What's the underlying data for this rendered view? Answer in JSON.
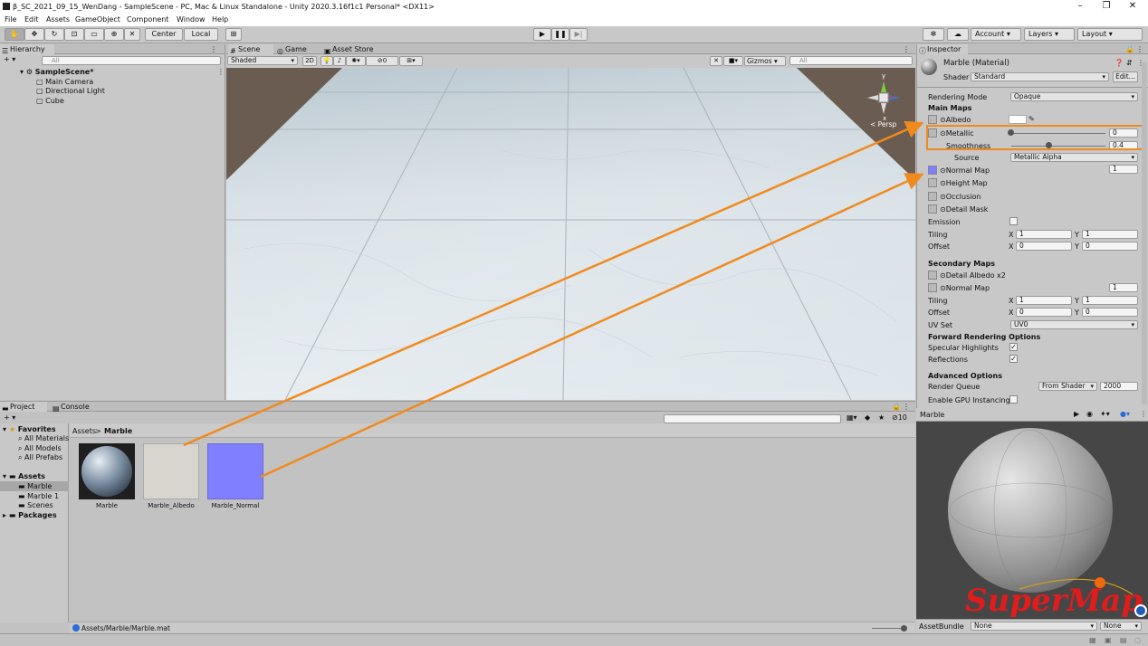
{
  "window": {
    "title": "β_SC_2021_09_15_WenDang - SampleScene - PC, Mac & Linux Standalone - Unity 2020.3.16f1c1 Personal* <DX11>",
    "minimize": "–",
    "maximize": "❐",
    "close": "✕"
  },
  "menu": [
    "File",
    "Edit",
    "Assets",
    "GameObject",
    "Component",
    "Window",
    "Help"
  ],
  "toolbar": {
    "pivot": "Center",
    "space": "Local",
    "account": "Account",
    "layers": "Layers",
    "layout": "Layout"
  },
  "hierarchy": {
    "tab": "Hierarchy",
    "add": "+ ▾",
    "search_placeholder": "All",
    "scene": "SampleScene*",
    "items": [
      "Main Camera",
      "Directional Light",
      "Cube"
    ]
  },
  "scene_view": {
    "tabs": [
      "Scene",
      "Game",
      "Asset Store"
    ],
    "shading": "Shaded",
    "mode2d": "2D",
    "fx_count": "0",
    "gizmos": "Gizmos",
    "search_placeholder": "All",
    "axis_y": "y",
    "axis_x": "x",
    "persp": "< Persp"
  },
  "project": {
    "tabs": [
      "Project",
      "Console"
    ],
    "add": "+ ▾",
    "favorites": "Favorites",
    "fav_items": [
      "All Materials",
      "All Models",
      "All Prefabs"
    ],
    "assets_root": "Assets",
    "asset_folders": [
      "Marble",
      "Marble 1",
      "Scenes"
    ],
    "packages": "Packages",
    "breadcrumb_root": "Assets",
    "breadcrumb_sep": ">",
    "breadcrumb_current": "Marble",
    "hidden_count": "10",
    "assets": [
      {
        "name": "Marble",
        "kind": "material"
      },
      {
        "name": "Marble_Albedo",
        "kind": "texture"
      },
      {
        "name": "Marble_Normal",
        "kind": "normal"
      }
    ],
    "status_path": "Assets/Marble/Marble.mat"
  },
  "inspector": {
    "tab": "Inspector",
    "title": "Marble (Material)",
    "shader_label": "Shader",
    "shader_value": "Standard",
    "edit_btn": "Edit...",
    "rendering_mode_label": "Rendering Mode",
    "rendering_mode": "Opaque",
    "main_maps": "Main Maps",
    "albedo": "Albedo",
    "metallic": "Metallic",
    "metallic_value": "0",
    "metallic_level": 0.0,
    "smoothness": "Smoothness",
    "smoothness_value": "0.4",
    "smoothness_level": 0.4,
    "source_label": "Source",
    "source_value": "Metallic Alpha",
    "normal_map": "Normal Map",
    "normal_map_value": "1",
    "height_map": "Height Map",
    "occlusion": "Occlusion",
    "detail_mask": "Detail Mask",
    "emission": "Emission",
    "tiling": "Tiling",
    "offset": "Offset",
    "x": "X",
    "y": "Y",
    "tiling_x": "1",
    "tiling_y": "1",
    "offset_x": "0",
    "offset_y": "0",
    "secondary_maps": "Secondary Maps",
    "detail_albedo": "Detail Albedo x2",
    "normal_map2": "Normal Map",
    "normal_map2_value": "1",
    "tiling2_x": "1",
    "tiling2_y": "1",
    "offset2_x": "0",
    "offset2_y": "0",
    "uv_set_label": "UV Set",
    "uv_set": "UV0",
    "forward_options": "Forward Rendering Options",
    "specular_highlights": "Specular Highlights",
    "reflections": "Reflections",
    "checked": "✓",
    "advanced_options": "Advanced Options",
    "render_queue": "Render Queue",
    "render_queue_mode": "From Shader",
    "render_queue_value": "2000",
    "gpu_instancing": "Enable GPU Instancing",
    "preview_title": "Marble",
    "assetbundle_label": "AssetBundle",
    "assetbundle_value": "None",
    "assetbundle_variant": "None"
  },
  "watermark": "SuperMap",
  "colors": {
    "highlight": "#f08a1e",
    "normal_map": "#7f7fff",
    "scene_bg": "#6b5c51",
    "floor": "#d2dde3"
  }
}
